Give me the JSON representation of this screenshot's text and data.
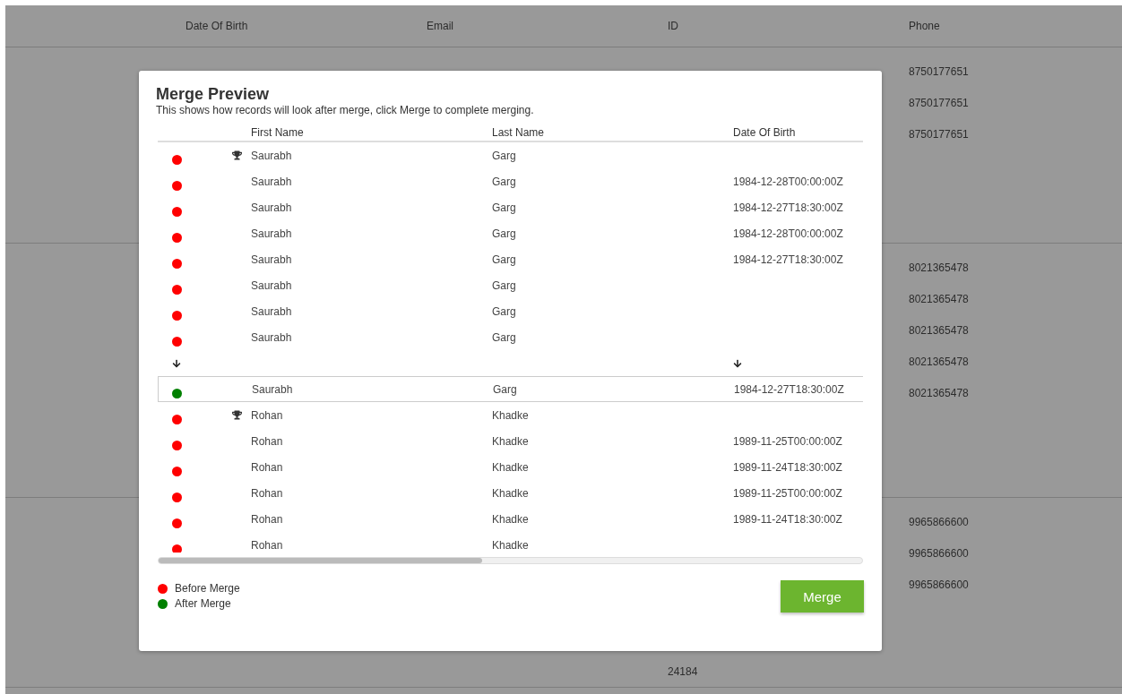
{
  "background_table": {
    "columns": [
      {
        "label": "Date Of Birth"
      },
      {
        "label": "Email"
      },
      {
        "label": "ID"
      },
      {
        "label": "Phone"
      }
    ],
    "groups": [
      {
        "rows": [
          {
            "phone": "8750177651"
          },
          {
            "phone": "8750177651"
          },
          {
            "phone": "8750177651"
          }
        ]
      },
      {
        "rows": [
          {
            "phone": "8021365478"
          },
          {
            "phone": "8021365478"
          },
          {
            "phone": "8021365478"
          },
          {
            "phone": "8021365478"
          },
          {
            "phone": "8021365478"
          }
        ]
      },
      {
        "rows": [
          {
            "phone": "9965866600"
          },
          {
            "phone": "9965866600"
          },
          {
            "phone": "9965866600"
          },
          {
            "id": "24184"
          }
        ]
      }
    ]
  },
  "dialog": {
    "title": "Merge Preview",
    "subtitle": "This shows how records will look after merge, click Merge to complete merging.",
    "columns": [
      {
        "label": "First Name"
      },
      {
        "label": "Last Name"
      },
      {
        "label": "Date Of Birth"
      }
    ],
    "rows": [
      {
        "kind": "record",
        "color": "#ff0000",
        "winner": true,
        "first_name": "Saurabh",
        "last_name": "Garg",
        "date_of_birth": ""
      },
      {
        "kind": "record",
        "color": "#ff0000",
        "winner": false,
        "first_name": "Saurabh",
        "last_name": "Garg",
        "date_of_birth": "1984-12-28T00:00:00Z"
      },
      {
        "kind": "record",
        "color": "#ff0000",
        "winner": false,
        "first_name": "Saurabh",
        "last_name": "Garg",
        "date_of_birth": "1984-12-27T18:30:00Z"
      },
      {
        "kind": "record",
        "color": "#ff0000",
        "winner": false,
        "first_name": "Saurabh",
        "last_name": "Garg",
        "date_of_birth": "1984-12-28T00:00:00Z"
      },
      {
        "kind": "record",
        "color": "#ff0000",
        "winner": false,
        "first_name": "Saurabh",
        "last_name": "Garg",
        "date_of_birth": "1984-12-27T18:30:00Z"
      },
      {
        "kind": "record",
        "color": "#ff0000",
        "winner": false,
        "first_name": "Saurabh",
        "last_name": "Garg",
        "date_of_birth": ""
      },
      {
        "kind": "record",
        "color": "#ff0000",
        "winner": false,
        "first_name": "Saurabh",
        "last_name": "Garg",
        "date_of_birth": ""
      },
      {
        "kind": "record",
        "color": "#ff0000",
        "winner": false,
        "first_name": "Saurabh",
        "last_name": "Garg",
        "date_of_birth": ""
      },
      {
        "kind": "arrow"
      },
      {
        "kind": "merged",
        "color": "#008000",
        "first_name": "Saurabh",
        "last_name": "Garg",
        "date_of_birth": "1984-12-27T18:30:00Z"
      },
      {
        "kind": "record",
        "color": "#ff0000",
        "winner": true,
        "first_name": "Rohan",
        "last_name": "Khadke",
        "date_of_birth": ""
      },
      {
        "kind": "record",
        "color": "#ff0000",
        "winner": false,
        "first_name": "Rohan",
        "last_name": "Khadke",
        "date_of_birth": "1989-11-25T00:00:00Z"
      },
      {
        "kind": "record",
        "color": "#ff0000",
        "winner": false,
        "first_name": "Rohan",
        "last_name": "Khadke",
        "date_of_birth": "1989-11-24T18:30:00Z"
      },
      {
        "kind": "record",
        "color": "#ff0000",
        "winner": false,
        "first_name": "Rohan",
        "last_name": "Khadke",
        "date_of_birth": "1989-11-25T00:00:00Z"
      },
      {
        "kind": "record",
        "color": "#ff0000",
        "winner": false,
        "first_name": "Rohan",
        "last_name": "Khadke",
        "date_of_birth": "1989-11-24T18:30:00Z"
      },
      {
        "kind": "record",
        "color": "#ff0000",
        "winner": false,
        "first_name": "Rohan",
        "last_name": "Khadke",
        "date_of_birth": ""
      }
    ],
    "legend": [
      {
        "label": "Before Merge",
        "color": "#ff0000"
      },
      {
        "label": "After Merge",
        "color": "#008000"
      }
    ],
    "button": "Merge"
  }
}
